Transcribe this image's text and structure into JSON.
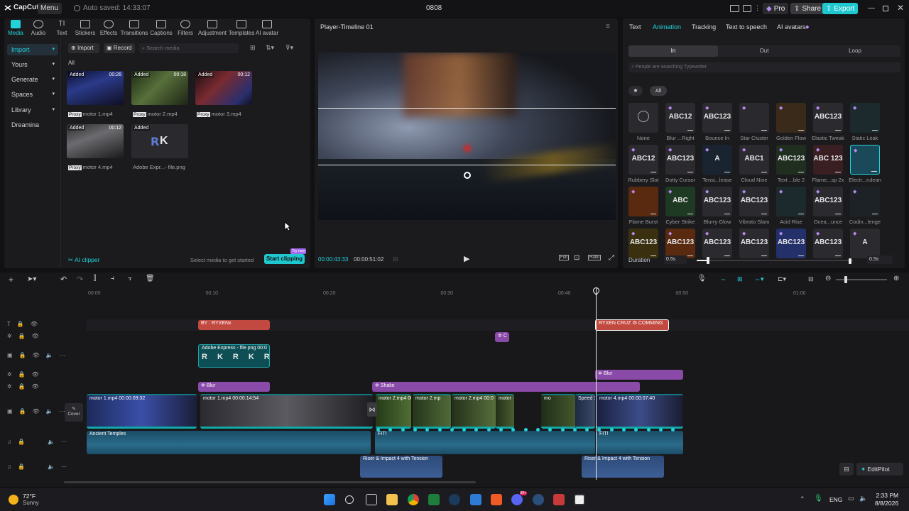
{
  "titlebar": {
    "app_name": "CapCut",
    "menu_label": "Menu",
    "autosave": "Auto saved: 14:33:07",
    "project_name": "0808",
    "pro_label": "Pro",
    "share_label": "Share",
    "export_label": "Export"
  },
  "media_toolbar": {
    "items": [
      "Media",
      "Audio",
      "Text",
      "Stickers",
      "Effects",
      "Transitions",
      "Captions",
      "Filters",
      "Adjustment",
      "Templates",
      "AI avatar"
    ]
  },
  "media_sidebar": {
    "items": [
      "Import",
      "Yours",
      "Generate",
      "Spaces",
      "Library",
      "Dreamina"
    ]
  },
  "media_controls": {
    "import_label": "Import",
    "record_label": "Record",
    "search_placeholder": "Search media",
    "filter_all": "All"
  },
  "media_items": [
    {
      "tag": "Added",
      "duration": "00:26",
      "proxy": "Proxy",
      "name": "motor 1.mp4"
    },
    {
      "tag": "Added",
      "duration": "00:18",
      "proxy": "Proxy",
      "name": "motor 2.mp4"
    },
    {
      "tag": "Added",
      "duration": "00:12",
      "proxy": "Proxy",
      "name": "motor 3.mp4"
    },
    {
      "tag": "Added",
      "duration": "00:12",
      "proxy": "Proxy",
      "name": "motor 4.mp4"
    },
    {
      "tag": "Added",
      "duration": "",
      "proxy": "",
      "name": "Adobe Expr...- file.png"
    }
  ],
  "media_footer": {
    "ai_clipper": "AI clipper",
    "hint": "Select media to get started",
    "start_clipping": "Start clipping",
    "try_now": "Try now"
  },
  "player": {
    "title": "Player-Timeline 01",
    "current_time": "00:00:43:33",
    "total_time": "00:00:51:02",
    "full_label": "Full",
    "ratio_label": "Ratio"
  },
  "anim_panel": {
    "tabs": [
      "Text",
      "Animation",
      "Tracking",
      "Text to speech",
      "AI avatars"
    ],
    "subtabs": [
      "In",
      "Out",
      "Loop"
    ],
    "search_placeholder": "People are searching Typewriter",
    "filter_all": "All",
    "duration_label": "Duration",
    "duration_value": "0.5s",
    "duration_value2": "0.5s",
    "presets": [
      {
        "name": "None",
        "text": ""
      },
      {
        "name": "Blur ...Right",
        "text": "ABC12"
      },
      {
        "name": "Bounce In",
        "text": "ABC123"
      },
      {
        "name": "Star Cluster",
        "text": ""
      },
      {
        "name": "Golden Flow",
        "text": ""
      },
      {
        "name": "Elastic Tweak",
        "text": "ABC123"
      },
      {
        "name": "Static Leak",
        "text": ""
      },
      {
        "name": "Rubbery Slot",
        "text": "ABC12"
      },
      {
        "name": "Dotty Cursor",
        "text": "ABC123"
      },
      {
        "name": "Tensi...lease",
        "text": "A"
      },
      {
        "name": "Cloud Nine",
        "text": "ABC1"
      },
      {
        "name": "Text ...ble 2",
        "text": "ABC123"
      },
      {
        "name": "Flame...sp 2x",
        "text": "ABC 123"
      },
      {
        "name": "Electr...rulean",
        "text": ""
      },
      {
        "name": "Flame Burst",
        "text": ""
      },
      {
        "name": "Cyber Strike",
        "text": "ABC"
      },
      {
        "name": "Blurry Glow",
        "text": "ABC123"
      },
      {
        "name": "Vibrato Slam",
        "text": "ABC123"
      },
      {
        "name": "Acid Rise",
        "text": ""
      },
      {
        "name": "Ocea...unce",
        "text": "ABC123"
      },
      {
        "name": "Codin...lenge",
        "text": ""
      },
      {
        "name": "",
        "text": "ABC123"
      },
      {
        "name": "",
        "text": "ABC123"
      },
      {
        "name": "",
        "text": "ABC123"
      },
      {
        "name": "",
        "text": "ABC123"
      },
      {
        "name": "",
        "text": "ABC123"
      },
      {
        "name": "",
        "text": "ABC123"
      },
      {
        "name": "",
        "text": "A"
      }
    ]
  },
  "timeline": {
    "ticks": [
      "00:00",
      "00:10",
      "00:20",
      "00:30",
      "00:40",
      "00:50",
      "01:00"
    ],
    "cover_label": "Cover",
    "text_clips": [
      "BY : RYXENx",
      "RYXEN CRUZ IS COMMING"
    ],
    "small_clip": "C",
    "image_clip": "Adobe Express - file.png  00:0",
    "effects": [
      "Blur",
      "Blur",
      "Shake"
    ],
    "video_clips": [
      {
        "name": "motor 1.mp4",
        "dur": "00:00:09:32"
      },
      {
        "name": "motor 1.mp4",
        "dur": "00:00:14:54"
      },
      {
        "name": "motor 2.mp4",
        "dur": "00"
      },
      {
        "name": "motor 2.mp",
        "dur": ""
      },
      {
        "name": "motor 2.mp4",
        "dur": "00:0"
      },
      {
        "name": "motor",
        "dur": ""
      },
      {
        "name": "mo",
        "dur": ""
      },
      {
        "name": "Speed 1",
        "dur": ""
      },
      {
        "name": "motor 4.mp4",
        "dur": "00:00:07:40"
      }
    ],
    "audio_clips": [
      "Ancient Temples",
      "FIT!",
      "FIT!"
    ],
    "sfx_clips": [
      "Riser & Impact 4 with Tension",
      "Riser & Impact 4 with Tension"
    ],
    "editpilot": "EditPilot"
  },
  "taskbar": {
    "temperature": "72°F",
    "weather": "Sunny",
    "language": "ENG",
    "time": "2:33 PM",
    "date": "8/8/2026",
    "badge": "99+"
  }
}
